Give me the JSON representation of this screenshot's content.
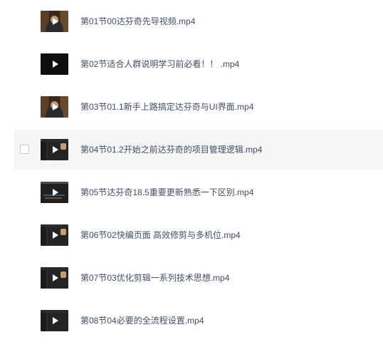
{
  "files": [
    {
      "name": "第01节00达芬奇先导视频.mp4",
      "icon": "video-thumbnail-icon",
      "thumb": "person"
    },
    {
      "name": "第02节适合人群说明学习前必看！！ .mp4",
      "icon": "video-thumbnail-icon",
      "thumb": "plain"
    },
    {
      "name": "第03节01.1新手上路搞定达芬奇与UI界面.mp4",
      "icon": "video-thumbnail-icon",
      "thumb": "person"
    },
    {
      "name": "第04节01.2开始之前达芬奇的项目管理逻辑.mp4",
      "icon": "video-thumbnail-icon",
      "thumb": "screen"
    },
    {
      "name": "第05节达芬奇18.5重要更新熟悉一下区别.mp4",
      "icon": "video-thumbnail-icon",
      "thumb": "screen-alt"
    },
    {
      "name": "第06节02快编页面 高效修剪与多机位.mp4",
      "icon": "video-thumbnail-icon",
      "thumb": "screen"
    },
    {
      "name": "第07节03优化剪辑一系列技术思想.mp4",
      "icon": "video-thumbnail-icon",
      "thumb": "screen"
    },
    {
      "name": "第08节04必要的全流程设置.mp4",
      "icon": "video-thumbnail-icon",
      "thumb": "screen"
    }
  ],
  "colors": {
    "text": "#424e67",
    "hover_row": "#f5f5f6",
    "checkbox_border": "#c9ccd1"
  }
}
